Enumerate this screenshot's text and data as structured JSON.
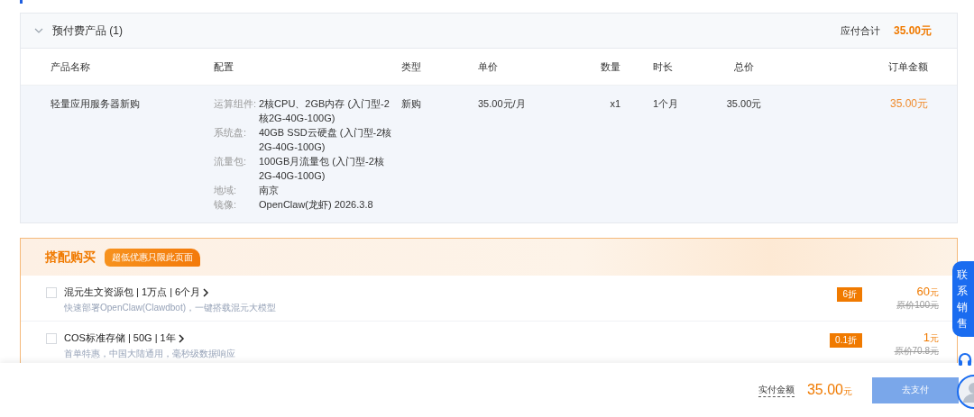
{
  "prepaid_group": {
    "title": "预付费产品 (1)",
    "expanded": true,
    "total_label": "应付合计",
    "total": "35.00元"
  },
  "table": {
    "columns": [
      "产品名称",
      "配置",
      "类型",
      "单价",
      "数量",
      "时长",
      "总价",
      "订单金额"
    ],
    "rows": [
      {
        "name": "轻量应用服务器新购",
        "config": [
          {
            "label": "运算组件:",
            "value": "2核CPU、2GB内存 (入门型-2核2G-40G-100G)"
          },
          {
            "label": "系统盘:",
            "value": "40GB SSD云硬盘 (入门型-2核2G-40G-100G)"
          },
          {
            "label": "流量包:",
            "value": "100GB月流量包 (入门型-2核2G-40G-100G)"
          },
          {
            "label": "地域:",
            "value": "南京"
          },
          {
            "label": "镜像:",
            "value": "OpenClaw(龙虾) 2026.3.8"
          }
        ],
        "type": "新购",
        "unit_price": "35.00元/月",
        "quantity": "x1",
        "duration": "1个月",
        "total": "35.00元",
        "order_amount": "35.00元"
      }
    ]
  },
  "bundle": {
    "title": "搭配购买",
    "badge": "超低优惠只限此页面",
    "items": [
      {
        "title": "混元生文资源包 | 1万点 | 6个月",
        "subtitle": "快速部署OpenClaw(Clawdbot)，一键搭载混元大模型",
        "checked": false,
        "discount": "6折",
        "price": "60",
        "price_unit": "元",
        "original_price": "原价100元"
      },
      {
        "title": "COS标准存储 | 50G | 1年",
        "subtitle": "首单特惠，中国大陆通用，毫秒级数据响应",
        "checked": false,
        "discount": "0.1折",
        "price": "1",
        "price_unit": "元",
        "original_price": "原价70.8元"
      }
    ]
  },
  "footer": {
    "label": "实付金额",
    "amount": "35.00",
    "unit": "元",
    "button": "去支付",
    "button_disabled": true
  },
  "contact_tab": "联系销售"
}
